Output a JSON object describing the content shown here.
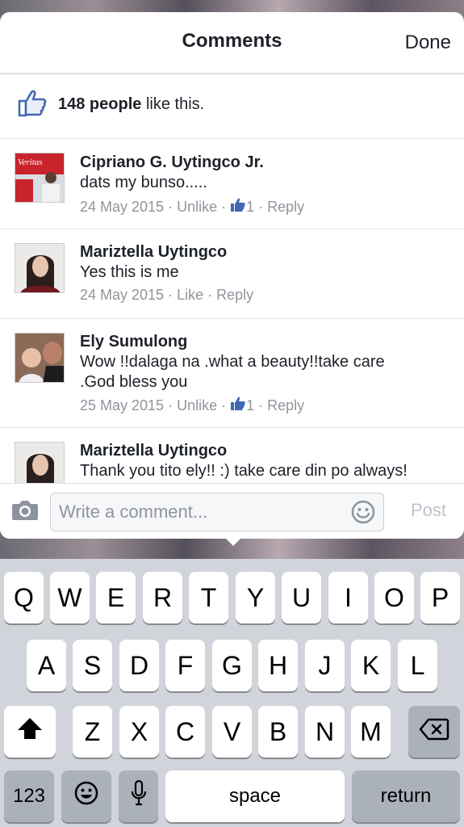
{
  "header": {
    "title": "Comments",
    "done_label": "Done"
  },
  "likes": {
    "count_text": "148 people",
    "suffix_text": " like this."
  },
  "comments": [
    {
      "name": "Cipriano G. Uytingco Jr.",
      "text": "dats my bunso.....",
      "date": "24 May 2015",
      "action": "Unlike",
      "like_count": "1",
      "reply": "Reply"
    },
    {
      "name": "Mariztella Uytingco",
      "text": "Yes this is me",
      "date": "24 May 2015",
      "action": "Like",
      "reply": "Reply"
    },
    {
      "name": "Ely Sumulong",
      "text": "Wow !!dalaga na .what a beauty!!take care .God bless you",
      "date": "25 May 2015",
      "action": "Unlike",
      "like_count": "1",
      "reply": "Reply"
    },
    {
      "name": "Mariztella Uytingco",
      "text": "Thank you tito ely!! :) take care din po always!"
    }
  ],
  "composer": {
    "placeholder": "Write a comment...",
    "post_label": "Post"
  },
  "separator": " · ",
  "keyboard": {
    "row1": [
      "Q",
      "W",
      "E",
      "R",
      "T",
      "Y",
      "U",
      "I",
      "O",
      "P"
    ],
    "row2": [
      "A",
      "S",
      "D",
      "F",
      "G",
      "H",
      "J",
      "K",
      "L"
    ],
    "row3": [
      "Z",
      "X",
      "C",
      "V",
      "B",
      "N",
      "M"
    ],
    "numbers_label": "123",
    "space_label": "space",
    "return_label": "return"
  },
  "colors": {
    "accent": "#4267b2",
    "meta": "#90949c",
    "text": "#1d2129"
  }
}
